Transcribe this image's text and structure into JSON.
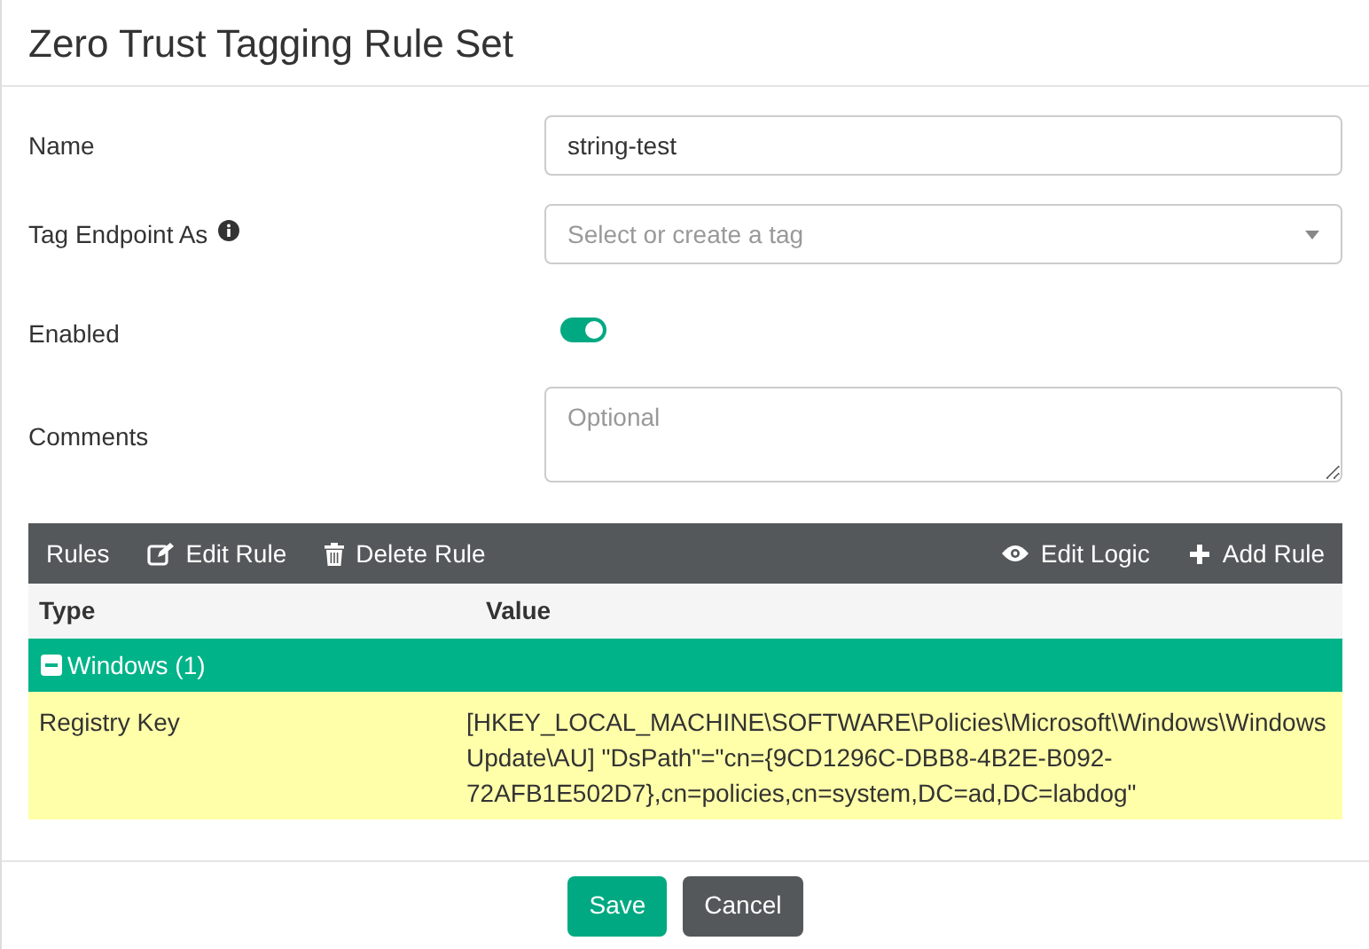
{
  "window": {
    "title": "Zero Trust Tagging Rule Set"
  },
  "form": [
    {
      "kind": "text",
      "label": "Name",
      "value": "string-test"
    },
    {
      "kind": "select",
      "label": "Tag Endpoint As",
      "info": true,
      "placeholder": "Select or create a tag"
    },
    {
      "kind": "toggle",
      "label": "Enabled",
      "on": true
    },
    {
      "kind": "textarea",
      "label": "Comments",
      "placeholder": "Optional"
    }
  ],
  "toolbar": {
    "left": [
      {
        "kind": "label",
        "label": "Rules"
      },
      {
        "kind": "edit",
        "label": "Edit Rule"
      },
      {
        "kind": "delete",
        "label": "Delete Rule"
      }
    ],
    "right": [
      {
        "kind": "eye",
        "label": "Edit Logic"
      },
      {
        "kind": "add",
        "label": "Add Rule"
      }
    ]
  },
  "table": {
    "columns": [
      "Type",
      "Value"
    ],
    "groups": [
      {
        "label": "Windows (1)",
        "expanded": true,
        "rows": [
          {
            "type": "Registry Key",
            "value": "[HKEY_LOCAL_MACHINE\\SOFTWARE\\Policies\\Microsoft\\Windows\\WindowsUpdate\\AU] \"DsPath\"=\"cn={9CD1296C-DBB8-4B2E-B092-72AFB1E502D7},cn=policies,cn=system,DC=ad,DC=labdog\""
          }
        ]
      }
    ]
  },
  "buttons": [
    {
      "kind": "primary",
      "label": "Save"
    },
    {
      "kind": "secondary",
      "label": "Cancel"
    }
  ]
}
